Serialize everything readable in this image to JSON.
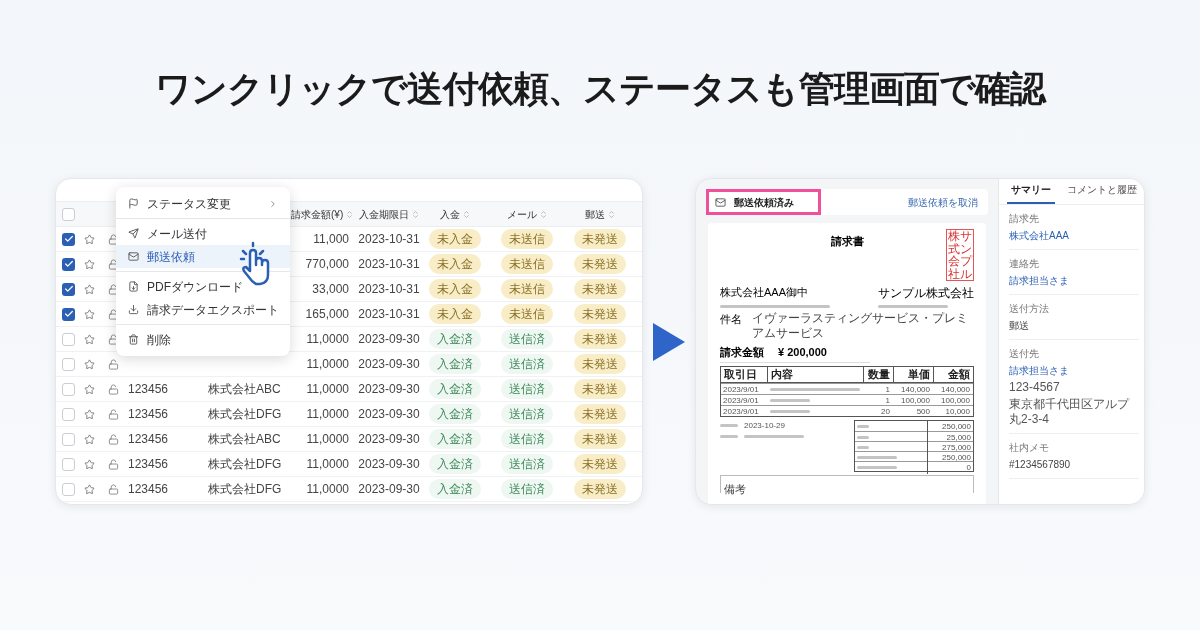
{
  "headline": "ワンクリックで送付依頼、ステータスも管理画面で確認",
  "table": {
    "header_checked": false,
    "columns": [
      {
        "label": "請求金額(¥)"
      },
      {
        "label": "入金期限日"
      },
      {
        "label": "入金"
      },
      {
        "label": "メール"
      },
      {
        "label": "郵送"
      }
    ],
    "rows": [
      {
        "checked": true,
        "amount": "11,000",
        "due": "2023-10-31",
        "payment": {
          "label": "未入金",
          "done": false
        },
        "mail": {
          "label": "未送信",
          "done": false
        },
        "post": {
          "label": "未発送",
          "done": false
        }
      },
      {
        "checked": true,
        "amount": "770,000",
        "due": "2023-10-31",
        "payment": {
          "label": "未入金",
          "done": false
        },
        "mail": {
          "label": "未送信",
          "done": false
        },
        "post": {
          "label": "未発送",
          "done": false
        }
      },
      {
        "checked": true,
        "amount": "33,000",
        "due": "2023-10-31",
        "payment": {
          "label": "未入金",
          "done": false
        },
        "mail": {
          "label": "未送信",
          "done": false
        },
        "post": {
          "label": "未発送",
          "done": false
        }
      },
      {
        "checked": true,
        "amount": "165,000",
        "due": "2023-10-31",
        "payment": {
          "label": "未入金",
          "done": false
        },
        "mail": {
          "label": "未送信",
          "done": false
        },
        "post": {
          "label": "未発送",
          "done": false
        }
      },
      {
        "checked": false,
        "amount": "11,0000",
        "due": "2023-09-30",
        "payment": {
          "label": "入金済",
          "done": true
        },
        "mail": {
          "label": "送信済",
          "done": true
        },
        "post": {
          "label": "未発送",
          "done": false
        }
      },
      {
        "checked": false,
        "amount": "11,0000",
        "due": "2023-09-30",
        "payment": {
          "label": "入金済",
          "done": true
        },
        "mail": {
          "label": "送信済",
          "done": true
        },
        "post": {
          "label": "未発送",
          "done": false
        }
      },
      {
        "checked": false,
        "id": "123456",
        "company": "株式会社ABC",
        "amount": "11,0000",
        "due": "2023-09-30",
        "payment": {
          "label": "入金済",
          "done": true
        },
        "mail": {
          "label": "送信済",
          "done": true
        },
        "post": {
          "label": "未発送",
          "done": false
        }
      },
      {
        "checked": false,
        "id": "123456",
        "company": "株式会社DFG",
        "amount": "11,0000",
        "due": "2023-09-30",
        "payment": {
          "label": "入金済",
          "done": true
        },
        "mail": {
          "label": "送信済",
          "done": true
        },
        "post": {
          "label": "未発送",
          "done": false
        }
      },
      {
        "checked": false,
        "id": "123456",
        "company": "株式会社ABC",
        "amount": "11,0000",
        "due": "2023-09-30",
        "payment": {
          "label": "入金済",
          "done": true
        },
        "mail": {
          "label": "送信済",
          "done": true
        },
        "post": {
          "label": "未発送",
          "done": false
        }
      },
      {
        "checked": false,
        "id": "123456",
        "company": "株式会社DFG",
        "amount": "11,0000",
        "due": "2023-09-30",
        "payment": {
          "label": "入金済",
          "done": true
        },
        "mail": {
          "label": "送信済",
          "done": true
        },
        "post": {
          "label": "未発送",
          "done": false
        }
      },
      {
        "checked": false,
        "id": "123456",
        "company": "株式会社DFG",
        "amount": "11,0000",
        "due": "2023-09-30",
        "payment": {
          "label": "入金済",
          "done": true
        },
        "mail": {
          "label": "送信済",
          "done": true
        },
        "post": {
          "label": "未発送",
          "done": false
        }
      }
    ]
  },
  "menu": {
    "groups": [
      [
        {
          "kind": "flag",
          "label": "ステータス変更",
          "submenu": true,
          "selected": false
        }
      ],
      [
        {
          "kind": "send",
          "label": "メール送付",
          "submenu": false,
          "selected": false
        },
        {
          "kind": "mail",
          "label": "郵送依頼",
          "submenu": false,
          "selected": true
        }
      ],
      [
        {
          "kind": "pdf",
          "label": "PDFダウンロード",
          "submenu": false,
          "selected": false
        },
        {
          "kind": "export",
          "label": "請求データエクスポート",
          "submenu": false,
          "selected": false
        }
      ],
      [
        {
          "kind": "trash",
          "label": "削除",
          "submenu": false,
          "selected": false
        }
      ]
    ]
  },
  "detail": {
    "status": "郵送依頼済み",
    "cancel_link": "郵送依頼を取消",
    "invoice": {
      "title": "請求書",
      "recipient": "株式会社AAA御中",
      "issuer": "サンプル株式会社",
      "stamp": [
        "株式会社",
        "サンプル"
      ],
      "subject_label": "件名",
      "subject": "イヴァーラスティングサービス・プレミアムサービス",
      "amount_label": "請求金額",
      "amount": "¥ 200,000",
      "columns": [
        "取引日",
        "内容",
        "数量",
        "単価",
        "金額"
      ],
      "lines": [
        {
          "date": "2023/9/01",
          "qty": "1",
          "price": "140,000",
          "total": "140,000"
        },
        {
          "date": "2023/9/01",
          "qty": "1",
          "price": "100,000",
          "total": "100,000"
        },
        {
          "date": "2023/9/01",
          "qty": "20",
          "price": "500",
          "total": "10,000"
        }
      ],
      "due_date": "2023-10-29",
      "totals": [
        "250,000",
        "25,000",
        "275,000",
        "250,000",
        "0"
      ],
      "notes_label": "備考"
    },
    "tabs": [
      {
        "label": "サマリー",
        "selected": true
      },
      {
        "label": "コメントと履歴",
        "selected": false
      }
    ],
    "fields": [
      {
        "label": "請求先",
        "value": "株式会社AAA",
        "link": true
      },
      {
        "label": "連絡先",
        "value": "請求担当さま",
        "link": true
      },
      {
        "label": "送付方法",
        "value": "郵送",
        "link": false
      },
      {
        "label": "送付先",
        "value": "請求担当さま",
        "link": true,
        "extra": [
          "123-4567",
          "東京都千代田区アルプ丸2-3-4"
        ]
      },
      {
        "label": "社内メモ",
        "value": "#1234567890",
        "link": false
      }
    ]
  }
}
